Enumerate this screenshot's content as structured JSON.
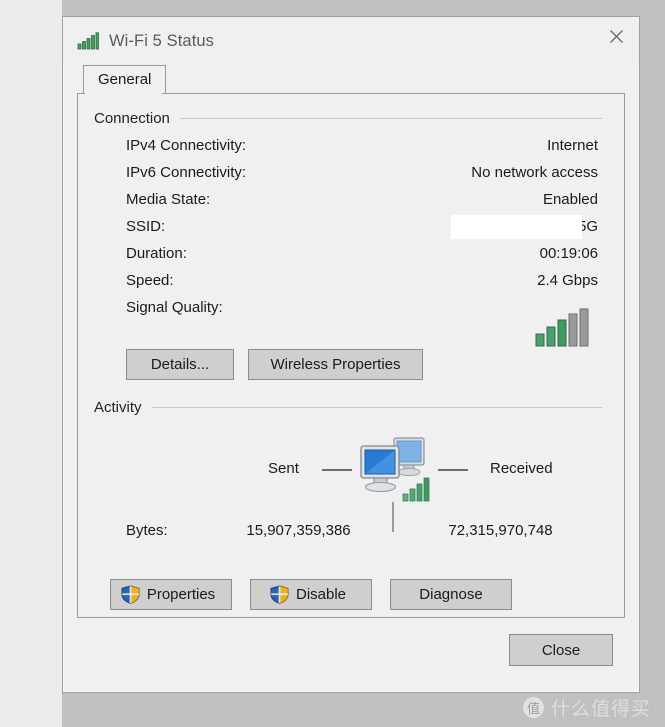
{
  "window": {
    "title": "Wi-Fi 5 Status",
    "title_icon": "signal-bars-icon",
    "close_icon": "close-icon"
  },
  "tabs": [
    {
      "label": "General",
      "active": true
    }
  ],
  "connection": {
    "group_label": "Connection",
    "rows": [
      {
        "label": "IPv4 Connectivity:",
        "value": "Internet"
      },
      {
        "label": "IPv6 Connectivity:",
        "value": "No network access"
      },
      {
        "label": "Media State:",
        "value": "Enabled"
      },
      {
        "label": "SSID:",
        "value": "5G",
        "redacted": true
      },
      {
        "label": "Duration:",
        "value": "00:19:06"
      },
      {
        "label": "Speed:",
        "value": "2.4 Gbps"
      }
    ],
    "signal_quality_label": "Signal Quality:",
    "signal_quality_bars_filled": 3,
    "signal_quality_bars_total": 5,
    "buttons": {
      "details": "Details...",
      "wireless_properties": "Wireless Properties"
    }
  },
  "activity": {
    "group_label": "Activity",
    "sent_label": "Sent",
    "received_label": "Received",
    "bytes_label": "Bytes:",
    "bytes_sent": "15,907,359,386",
    "bytes_received": "72,315,970,748",
    "icon": "two-computers-icon"
  },
  "actions": {
    "properties": "Properties",
    "disable": "Disable",
    "diagnose": "Diagnose"
  },
  "footer": {
    "close": "Close"
  },
  "watermark": {
    "logo": "值",
    "text": "什么值得买"
  },
  "colors": {
    "dialog_background": "#f0f0f0",
    "page_background": "#c0c0c0",
    "button_face": "#cfcfcf",
    "signal_green": "#3a9c5c",
    "signal_gray": "#8e8e8e",
    "shield_blue": "#2a62b4",
    "shield_gold": "#e8b221",
    "title_text": "#5a5a5a"
  }
}
